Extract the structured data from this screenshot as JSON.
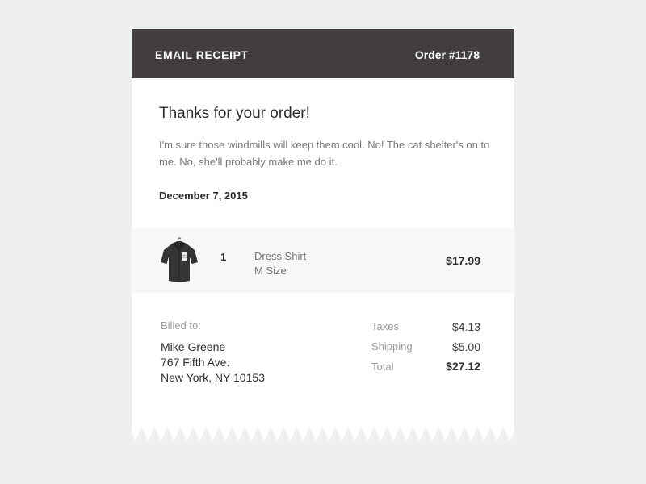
{
  "header": {
    "title": "EMAIL RECEIPT",
    "order": "Order #1178"
  },
  "main": {
    "thanks": "Thanks for your order!",
    "message": "I'm sure those windmills will keep them cool. No! The cat shelter's on to me. No, she'll probably make me do it.",
    "date": "December 7, 2015"
  },
  "item": {
    "image": "dress-shirt",
    "quantity": "1",
    "name": "Dress Shirt",
    "size": "M Size",
    "price": "$17.99"
  },
  "billing": {
    "label": "Billed to:",
    "name": "Mike Greene",
    "street": "767 Fifth Ave.",
    "city": "New York, NY 10153"
  },
  "totals": {
    "taxes_label": "Taxes",
    "taxes_value": "$4.13",
    "shipping_label": "Shipping",
    "shipping_value": "$5.00",
    "total_label": "Total",
    "total_value": "$27.12"
  },
  "colors": {
    "page_background": "#eef0ef",
    "header_background": "#423e3d",
    "item_background": "#f7f7f7"
  }
}
